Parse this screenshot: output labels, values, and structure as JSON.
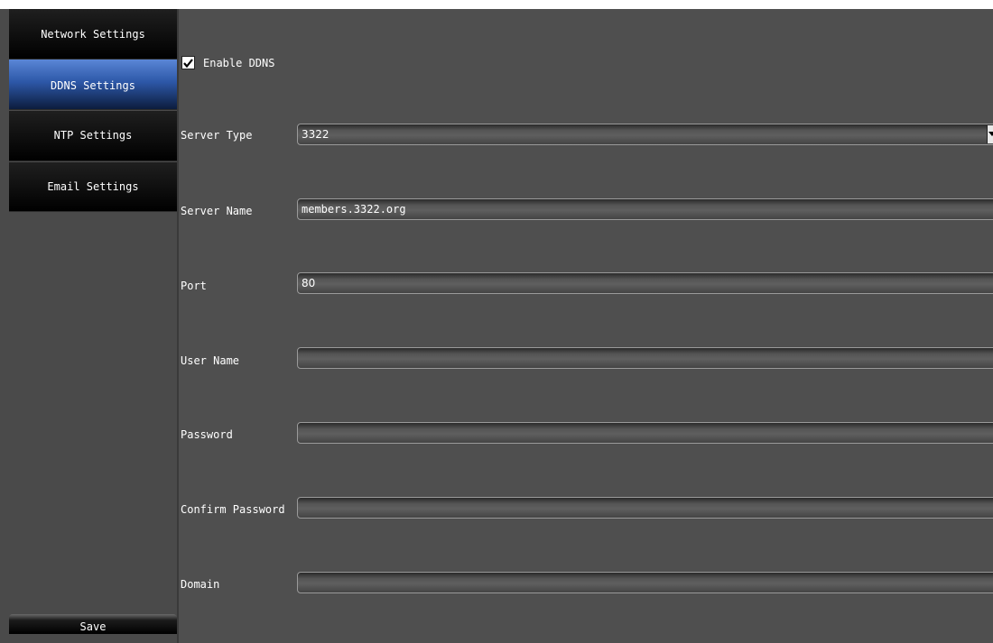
{
  "sidebar": {
    "items": [
      {
        "label": "Network Settings",
        "active": false
      },
      {
        "label": "DDNS Settings",
        "active": true
      },
      {
        "label": "NTP Settings",
        "active": false
      },
      {
        "label": "Email Settings",
        "active": false
      }
    ],
    "save_label": "Save"
  },
  "ddns": {
    "enable_label": "Enable DDNS",
    "enabled": true,
    "server_type": {
      "label": "Server Type",
      "value": "3322"
    },
    "server_name": {
      "label": "Server Name",
      "value": "members.3322.org"
    },
    "port": {
      "label": "Port",
      "value": "80"
    },
    "user_name": {
      "label": "User Name",
      "value": ""
    },
    "password": {
      "label": "Password",
      "value": ""
    },
    "confirm_password": {
      "label": "Confirm Password",
      "value": ""
    },
    "domain": {
      "label": "Domain",
      "value": ""
    }
  },
  "icons": {
    "checkbox": "checkmark-icon",
    "dropdown": "chevron-down-icon"
  },
  "colors": {
    "active_tab": "#2d58a8",
    "panel_background": "#4f4f4f",
    "nav_background": "#000000"
  }
}
